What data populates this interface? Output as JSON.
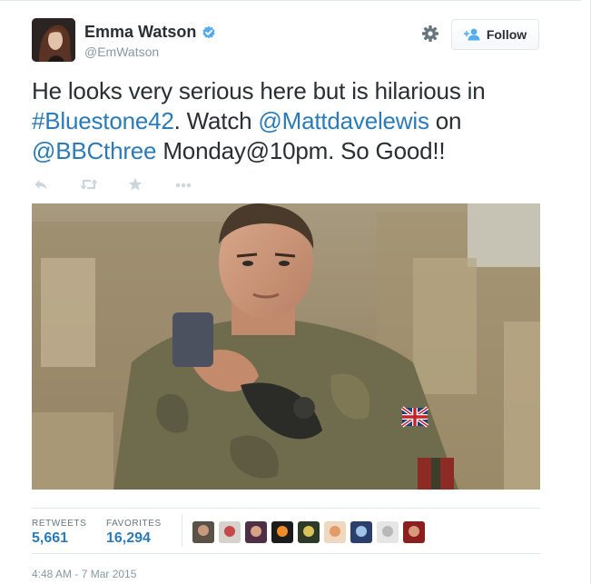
{
  "author": {
    "name": "Emma Watson",
    "handle": "@EmWatson",
    "verified": true
  },
  "follow_button": {
    "label": "Follow"
  },
  "tweet": {
    "segments": [
      {
        "text": "He looks very serious here but is hilarious in ",
        "link": false
      },
      {
        "text": "#Bluestone42",
        "link": true
      },
      {
        "text": ". Watch ",
        "link": false
      },
      {
        "text": "@Mattdavelewis",
        "link": true
      },
      {
        "text": " on ",
        "link": false
      },
      {
        "text": "@BBCthree",
        "link": true
      },
      {
        "text": " Monday@10pm. So Good!!",
        "link": false
      }
    ]
  },
  "actions": [
    "reply-icon",
    "retweet-icon",
    "favorite-icon",
    "more-icon"
  ],
  "stats": {
    "retweets_label": "RETWEETS",
    "retweets_value": "5,661",
    "favorites_label": "FAVORITES",
    "favorites_value": "16,294"
  },
  "favoriters_count": 9,
  "timestamp": "4:48 AM - 7 Mar 2015",
  "colors": {
    "link": "#2b7bb9",
    "text": "#292f33",
    "muted": "#8899a6",
    "verified": "#55acee",
    "border": "#e1e8ed"
  }
}
